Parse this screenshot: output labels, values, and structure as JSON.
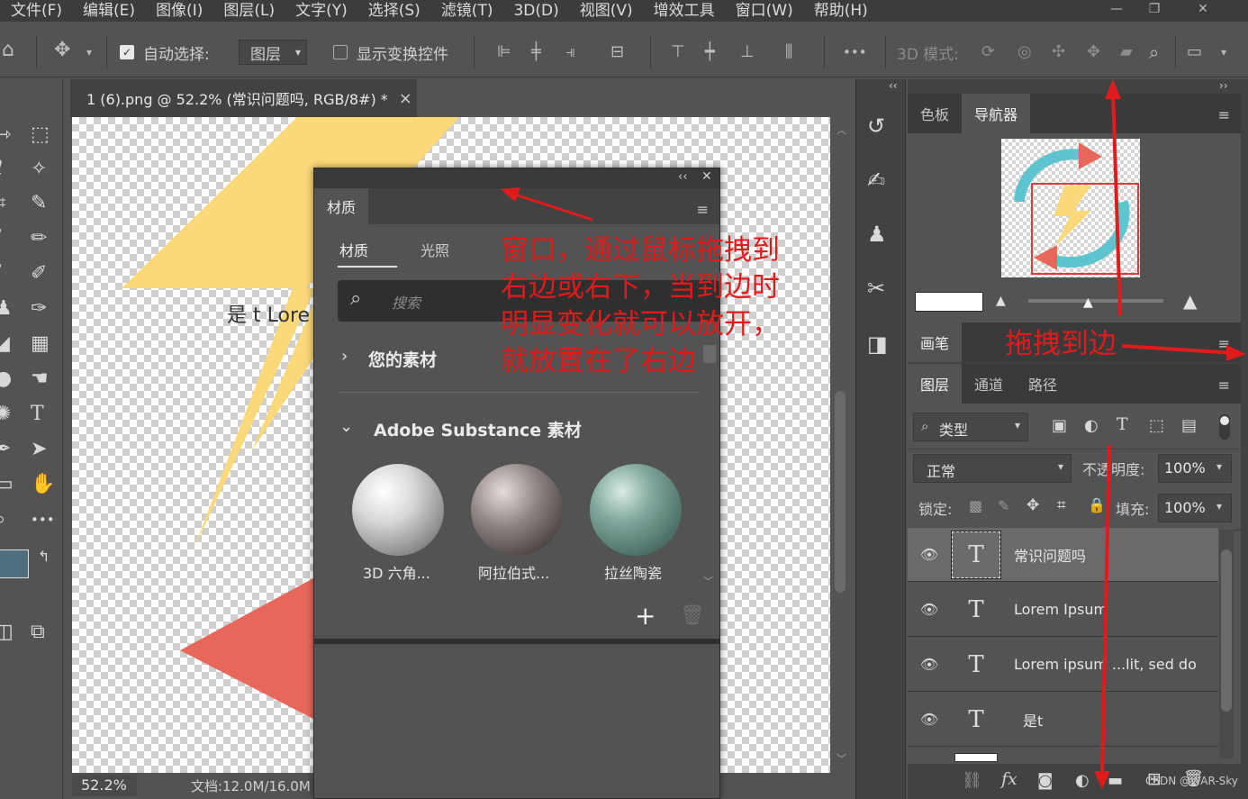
{
  "menu": {
    "items": [
      "文件(F)",
      "编辑(E)",
      "图像(I)",
      "图层(L)",
      "文字(Y)",
      "选择(S)",
      "滤镜(T)",
      "3D(D)",
      "视图(V)",
      "增效工具",
      "窗口(W)",
      "帮助(H)"
    ]
  },
  "window_controls": {
    "minimize": "—",
    "restore": "❐",
    "close": "✕"
  },
  "options": {
    "auto_select_label": "自动选择:",
    "auto_select_value": "图层",
    "show_transform_label": "显示变换控件",
    "mode_3d_label": "3D 模式:",
    "more": "•••"
  },
  "document": {
    "tab_title": "1 (6).png @ 52.2% (常识问题吗, RGB/8#) *",
    "tab_close": "×",
    "canvas_text": "是 t Lore",
    "zoom": "52.2%",
    "doc_info": "文档:12.0M/16.0M"
  },
  "materials_panel": {
    "panel_tab": "材质",
    "sub_tabs": [
      "材质",
      "光照"
    ],
    "search_placeholder": "搜索",
    "section_own": "您的素材",
    "section_substance": "Adobe Substance 素材",
    "items": [
      "3D 六角...",
      "阿拉伯式...",
      "拉丝陶瓷"
    ],
    "add_label": "+",
    "collapse": "‹‹",
    "close": "✕"
  },
  "navigator_panel": {
    "tabs": [
      "色板",
      "导航器"
    ],
    "active_tab": "导航器"
  },
  "brush_panel": {
    "tab": "画笔"
  },
  "layers_panel": {
    "tabs": [
      "图层",
      "通道",
      "路径"
    ],
    "filter_label": "类型",
    "blend_mode": "正常",
    "opacity_label": "不透明度:",
    "opacity_value": "100%",
    "lock_label": "锁定:",
    "fill_label": "填充:",
    "fill_value": "100%",
    "layers": [
      {
        "name": "常识问题吗",
        "type": "T",
        "selected": true
      },
      {
        "name": "Lorem Ipsum",
        "type": "T",
        "selected": false
      },
      {
        "name": "Lorem ipsum ...lit, sed do",
        "type": "T",
        "selected": false
      },
      {
        "name": "是t",
        "type": "T",
        "selected": false
      }
    ],
    "fx_label": "fx"
  },
  "annotations": {
    "main_lines": [
      "窗口，通过鼠标拖拽到",
      "右边或右下，当到边时",
      "明显变化就可以放开，",
      "就放置在了右边"
    ],
    "drag_to_edge": "拖拽到边",
    "watermark": "CSDN @WAR-Sky"
  },
  "colors": {
    "annotation_red": "#e11b1b",
    "foreground_swatch": "#4d6e7d",
    "background_swatch": "#000000",
    "bolt_yellow": "#fbd97a",
    "arrow_red": "#e8675b",
    "teal": "#5ec4cf"
  }
}
